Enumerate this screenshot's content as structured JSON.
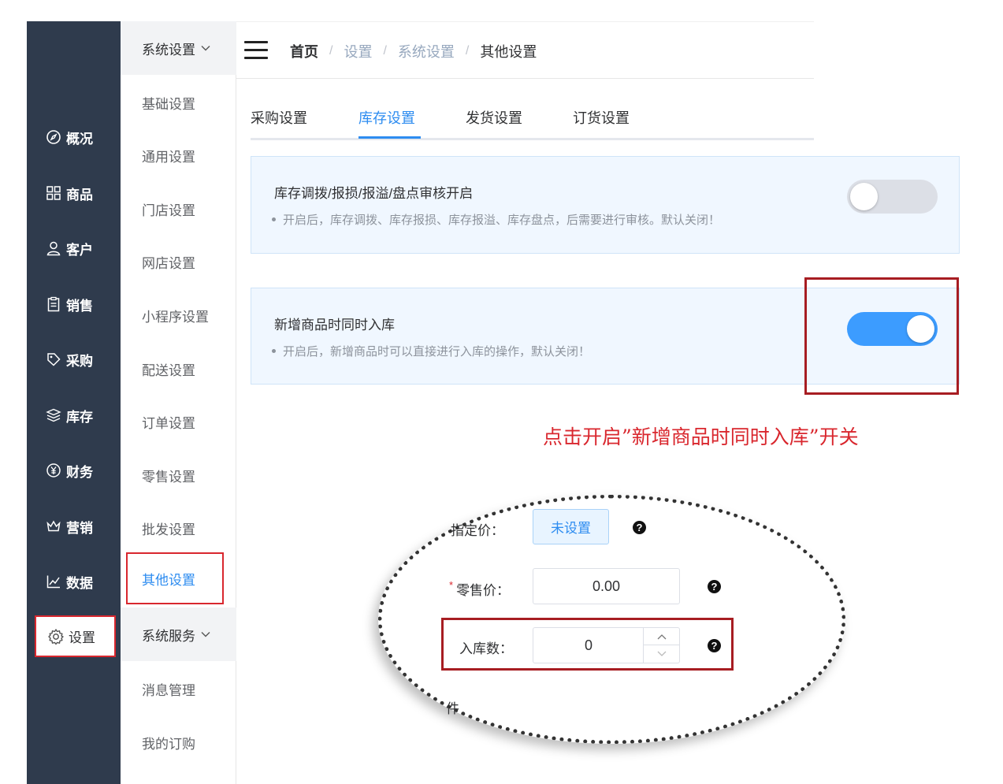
{
  "main_nav": [
    {
      "label": "概况",
      "icon": "compass-icon"
    },
    {
      "label": "商品",
      "icon": "grid-icon"
    },
    {
      "label": "客户",
      "icon": "user-icon"
    },
    {
      "label": "销售",
      "icon": "clipboard-icon"
    },
    {
      "label": "采购",
      "icon": "tag-icon"
    },
    {
      "label": "库存",
      "icon": "layers-icon"
    },
    {
      "label": "财务",
      "icon": "yen-icon"
    },
    {
      "label": "营销",
      "icon": "crown-icon"
    },
    {
      "label": "数据",
      "icon": "line-chart-icon"
    }
  ],
  "settings_nav": {
    "label": "设置",
    "icon": "gear-icon"
  },
  "sub_nav": {
    "group1": "系统设置",
    "items1": [
      "基础设置",
      "通用设置",
      "门店设置",
      "网店设置",
      "小程序设置",
      "配送设置",
      "订单设置",
      "零售设置",
      "批发设置"
    ],
    "active": "其他设置",
    "group2": "系统服务",
    "items2": [
      "消息管理",
      "我的订购"
    ]
  },
  "breadcrumb": [
    "首页",
    "设置",
    "系统设置",
    "其他设置"
  ],
  "tabs": [
    "采购设置",
    "库存设置",
    "发货设置",
    "订货设置"
  ],
  "active_tab": "库存设置",
  "cards": [
    {
      "title": "库存调拨/报损/报溢/盘点审核开启",
      "desc": "开启后，库存调拨、库存报损、库存报溢、库存盘点，后需要进行审核。默认关闭！",
      "enabled": false
    },
    {
      "title": "新增商品时同时入库",
      "desc": "开启后，新增商品时可以直接进行入库的操作，默认关闭！",
      "enabled": true
    }
  ],
  "annotation": "点击开启”新增商品时同时入库”开关",
  "form": {
    "fixed_price_label": "指定价：",
    "fixed_price_value": "未设置",
    "retail_price_label": "零售价：",
    "retail_price_value": "0.00",
    "stock_qty_label": "入库数：",
    "stock_qty_value": "0",
    "help": "?",
    "required_mark": "*",
    "cut_text": "件"
  },
  "colors": {
    "sidebar": "#2f3b4d",
    "accent": "#2d8cf0",
    "switch_on": "#3c9cff",
    "highlight": "#a71d22",
    "annotation": "#d9272e"
  }
}
